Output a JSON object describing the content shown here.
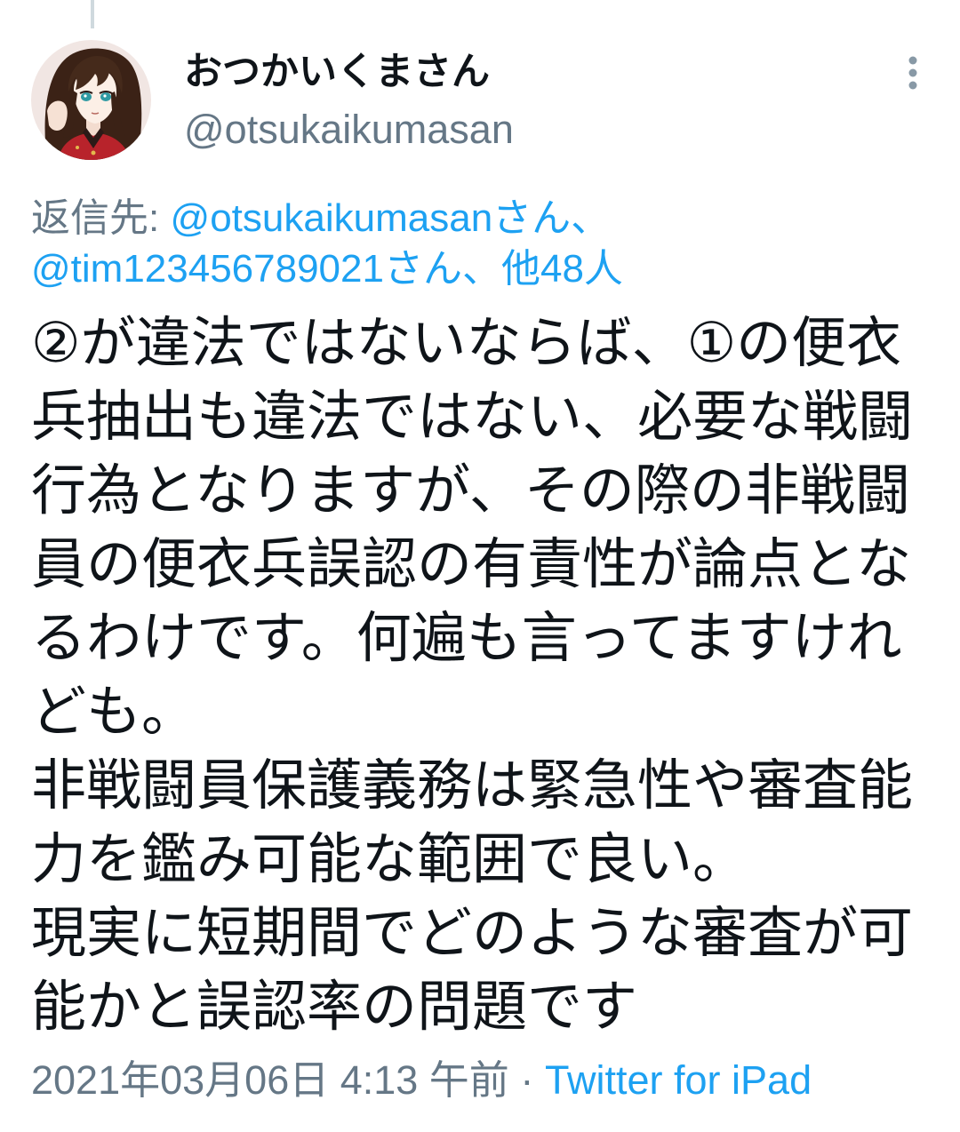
{
  "colors": {
    "background": "#ffffff",
    "text": "#0f1419",
    "secondary": "#657786",
    "link": "#1da1f2",
    "thread_line": "#cfd9de"
  },
  "icons": {
    "more": "more-vertical-icon"
  },
  "author": {
    "display_name": "おつかいくまさん",
    "handle": "@otsukaikumasan"
  },
  "reply_context": {
    "label": "返信先:",
    "mentions": [
      "@otsukaikumasanさん、",
      "@tim123456789021さん、"
    ],
    "others": "他48人"
  },
  "tweet": {
    "lines": [
      "②が違法ではないならば、①の便衣",
      "兵抽出も違法ではない、必要な戦闘",
      "行為となりますが、その際の非戦闘",
      "員の便衣兵誤認の有責性が論点とな",
      "るわけです。何遍も言ってますけれ",
      "ども。",
      "非戦闘員保護義務は緊急性や審査能",
      "力を鑑み可能な範囲で良い。",
      "現実に短期間でどのような審査が可",
      "能かと誤認率の問題です"
    ]
  },
  "meta": {
    "timestamp": "2021年03月06日 4:13 午前",
    "separator": "·",
    "source": "Twitter for iPad"
  }
}
